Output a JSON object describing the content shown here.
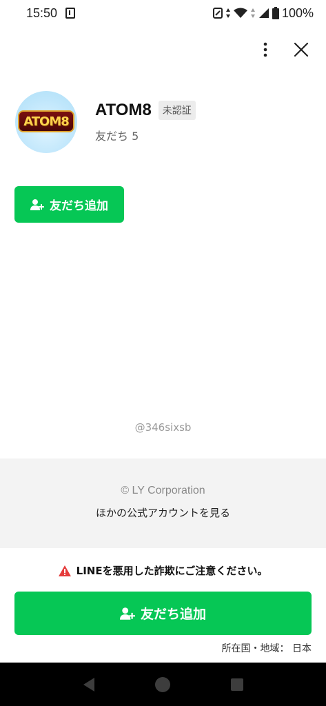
{
  "status_bar": {
    "time": "15:50",
    "battery": "100%"
  },
  "header": {
    "more_icon": "more-vertical-icon",
    "close_icon": "close-icon"
  },
  "profile": {
    "logo_text": "ATOM8",
    "name": "ATOM8",
    "badge": "未認証",
    "friends": "友だち 5"
  },
  "add_friend_button": {
    "label": "友だち追加"
  },
  "account_id": "@346sixsb",
  "footer": {
    "copyright": "© LY Corporation",
    "other_accounts": "ほかの公式アカウントを見る"
  },
  "warning": {
    "text": "LINEを悪用した詐欺にご注意ください。"
  },
  "bottom_button": {
    "label": "友だち追加"
  },
  "location": "所在国・地域： 日本",
  "colors": {
    "accent": "#06c755",
    "warning_icon": "#e53b3b"
  }
}
